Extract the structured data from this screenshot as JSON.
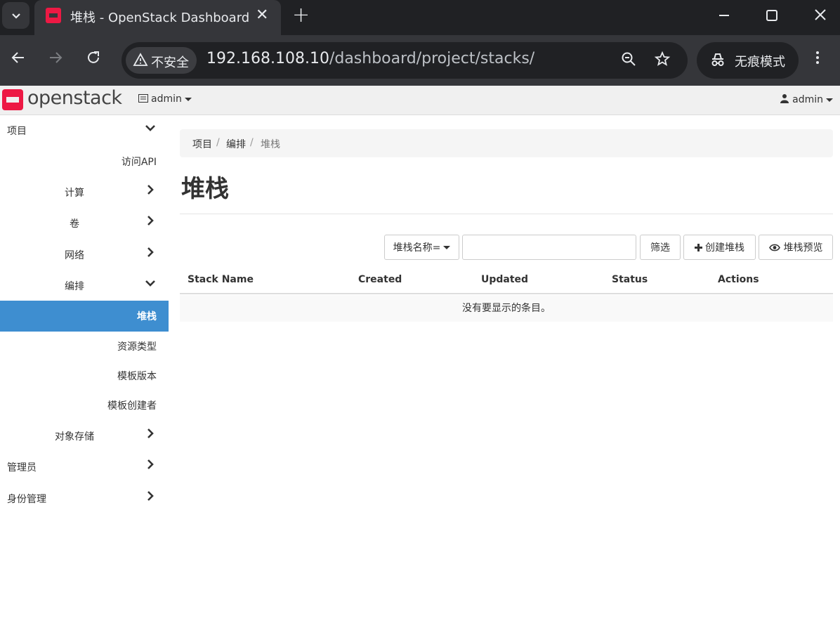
{
  "browser": {
    "tab_title": "堆栈 - OpenStack Dashboard",
    "tab_close": "✕",
    "new_tab": "+",
    "insecure_label": "不安全",
    "url_host": "192.168.108.10",
    "url_path": "/dashboard/project/stacks/",
    "incognito_label": "无痕模式"
  },
  "header": {
    "logo_text": "openstack",
    "project_menu": "admin",
    "user_menu": "admin"
  },
  "sidebar": {
    "items": [
      {
        "label": "项目",
        "chevron": "down"
      },
      {
        "label": "访问API",
        "chevron": ""
      },
      {
        "label": "计算",
        "chevron": "right"
      },
      {
        "label": "卷",
        "chevron": "right"
      },
      {
        "label": "网络",
        "chevron": "right"
      },
      {
        "label": "编排",
        "chevron": "down"
      },
      {
        "label": "堆栈",
        "chevron": "",
        "active": true
      },
      {
        "label": "资源类型",
        "chevron": ""
      },
      {
        "label": "模板版本",
        "chevron": ""
      },
      {
        "label": "模板创建者",
        "chevron": ""
      },
      {
        "label": "对象存储",
        "chevron": "right"
      },
      {
        "label": "管理员",
        "chevron": "right"
      },
      {
        "label": "身份管理",
        "chevron": "right"
      }
    ]
  },
  "breadcrumb": {
    "items": [
      "项目",
      "编排",
      "堆栈"
    ]
  },
  "page": {
    "title": "堆栈"
  },
  "actions": {
    "filter_field": "堆栈名称=",
    "filter_value": "",
    "filter_button": "筛选",
    "create_button": "创建堆栈",
    "preview_button": "堆栈预览"
  },
  "table": {
    "columns": [
      "Stack Name",
      "Created",
      "Updated",
      "Status",
      "Actions"
    ],
    "empty_message": "没有要显示的条目。"
  }
}
